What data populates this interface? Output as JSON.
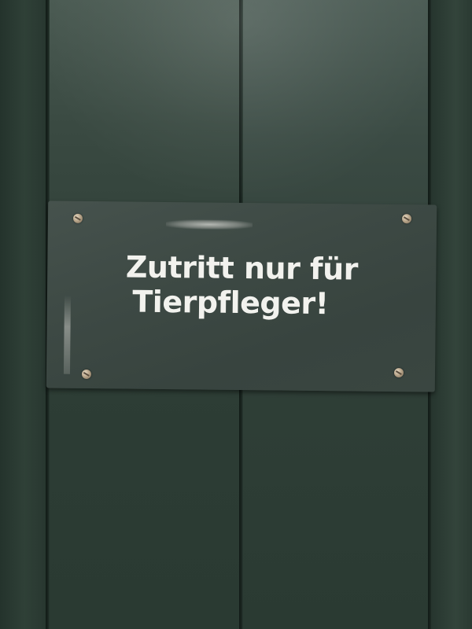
{
  "sign": {
    "line1": "Zutritt nur für",
    "line2": "Tierpfleger!"
  },
  "colors": {
    "door_green": "#2b3b33",
    "sign_plate": "#3d4944",
    "sign_text": "#f2f2ee"
  }
}
